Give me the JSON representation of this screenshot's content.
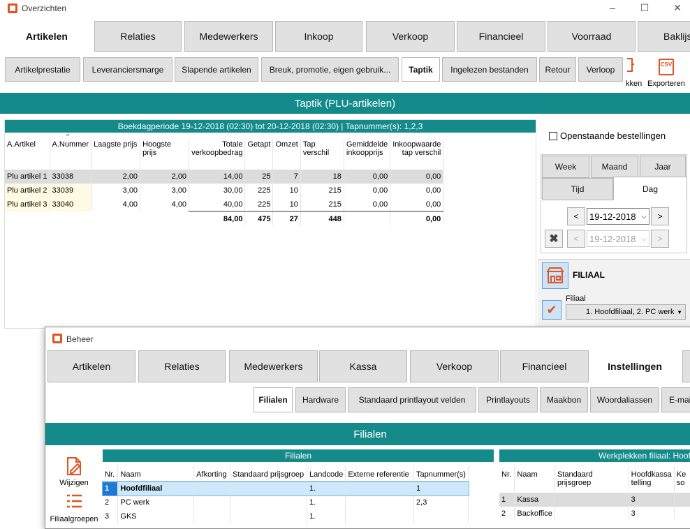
{
  "main_window": {
    "title": "Overzichten",
    "controls": [
      "–",
      "☐",
      "✕"
    ]
  },
  "main_tabs": [
    {
      "label": "Artikelen",
      "selected": true
    },
    {
      "label": "Relaties"
    },
    {
      "label": "Medewerkers"
    },
    {
      "label": "Inkoop"
    },
    {
      "label": "Verkoop"
    },
    {
      "label": "Financieel"
    },
    {
      "label": "Voorraad"
    },
    {
      "label": "Baklijst"
    }
  ],
  "sub_tabs": [
    {
      "label": "Artikelprestatie"
    },
    {
      "label": "Leveranciersmarge"
    },
    {
      "label": "Slapende artikelen"
    },
    {
      "label": "Breuk, promotie, eigen gebruik..."
    },
    {
      "label": "Taptik",
      "selected": true
    },
    {
      "label": "Ingelezen bestanden"
    },
    {
      "label": "Retour"
    },
    {
      "label": "Verloop"
    }
  ],
  "toolbar": {
    "partial_label": "kken",
    "export_label": "Exporteren",
    "csv_text": "CSV"
  },
  "section_title": "Taptik (PLU-artikelen)",
  "period_header": "Boekdagperiode 19-12-2018 (02:30) tot 20-12-2018 (02:30)  |  Tapnummer(s): 1,2,3",
  "table": {
    "columns": [
      "A.Artikel",
      "A.Nummer",
      "Laagste prijs",
      "Hoogste prijs",
      "Totale verkoopbedrag",
      "Getapt",
      "Omzet",
      "Tap verschil",
      "Gemiddelde inkoopprijs",
      "Inkoopwaarde tap verschil"
    ],
    "rows": [
      [
        "Plu artikel 1",
        "33038",
        "2,00",
        "2,00",
        "14,00",
        "25",
        "7",
        "18",
        "0,00",
        "0,00"
      ],
      [
        "Plu artikel 2",
        "33039",
        "3,00",
        "3,00",
        "30,00",
        "225",
        "10",
        "215",
        "0,00",
        "0,00"
      ],
      [
        "Plu artikel 3",
        "33040",
        "4,00",
        "4,00",
        "40,00",
        "225",
        "10",
        "215",
        "0,00",
        "0,00"
      ]
    ],
    "totals": {
      "totale": "84,00",
      "getapt": "475",
      "omzet": "27",
      "tap": "448",
      "inkoopwaarde": "0,00"
    }
  },
  "filters": {
    "open_orders": "Openstaande bestellingen",
    "period_tabs": [
      "Week",
      "Maand",
      "Jaar"
    ],
    "period_tabs2": [
      "Tijd",
      "Dag"
    ],
    "date_from": "19-12-2018",
    "date_to": "19-12-2018",
    "prev": "<",
    "next": ">"
  },
  "filiaal": {
    "title": "FILIAAL",
    "label": "Filiaal",
    "value": "1. Hoofdfiliaal, 2. PC werk"
  },
  "beheer": {
    "title": "Beheer",
    "tabs": [
      {
        "label": "Artikelen"
      },
      {
        "label": "Relaties"
      },
      {
        "label": "Medewerkers"
      },
      {
        "label": "Kassa"
      },
      {
        "label": "Verkoop"
      },
      {
        "label": "Financieel"
      },
      {
        "label": "Instellingen",
        "selected": true
      }
    ],
    "sub_tabs": [
      {
        "label": "Filialen",
        "selected": true
      },
      {
        "label": "Hardware"
      },
      {
        "label": "Standaard printlayout velden"
      },
      {
        "label": "Printlayouts"
      },
      {
        "label": "Maakbon"
      },
      {
        "label": "Woordaliassen"
      },
      {
        "label": "E-mail"
      }
    ],
    "section_title": "Filialen",
    "left_tools": [
      {
        "label": "Wijzigen"
      },
      {
        "label": "Filiaalgroepen"
      }
    ],
    "filialen": {
      "title": "Filialen",
      "columns": [
        "Nr.",
        "Naam",
        "Afkorting",
        "Standaard prijsgroep",
        "Landcode",
        "Externe referentie",
        "Tapnummer(s)"
      ],
      "rows": [
        [
          "1",
          "Hoofdfiliaal",
          "",
          "",
          "1.",
          "",
          "1"
        ],
        [
          "2",
          "PC werk",
          "",
          "",
          "1.",
          "",
          "2,3"
        ],
        [
          "3",
          "GKS",
          "",
          "",
          "1.",
          "",
          ""
        ]
      ]
    },
    "werkplekken": {
      "title": "Werkplekken filiaal: Hoofdfiliaal",
      "columns": [
        "Nr.",
        "Naam",
        "Standaard prijsgroep",
        "Hoofdkassa telling",
        "Ke so"
      ],
      "rows": [
        [
          "1",
          "Kassa",
          "",
          "3"
        ],
        [
          "2",
          "Backoffice",
          "",
          "3"
        ]
      ]
    }
  }
}
